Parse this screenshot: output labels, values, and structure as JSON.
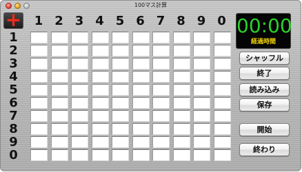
{
  "window": {
    "title": "100マス計算"
  },
  "operator": {
    "symbol": "+",
    "color": "#ee2a1a"
  },
  "column_headers": [
    "1",
    "2",
    "3",
    "4",
    "5",
    "6",
    "7",
    "8",
    "9",
    "0"
  ],
  "row_headers": [
    "1",
    "2",
    "3",
    "4",
    "5",
    "6",
    "7",
    "8",
    "9",
    "0"
  ],
  "timer": {
    "value": "00:00",
    "label": "経過時間",
    "value_color": "#2bd12b",
    "label_color": "#f1d300"
  },
  "buttons": {
    "shuffle": "シャッフル",
    "finish": "終了",
    "load": "読み込み",
    "save": "保存",
    "start": "開始",
    "end": "終わり"
  }
}
